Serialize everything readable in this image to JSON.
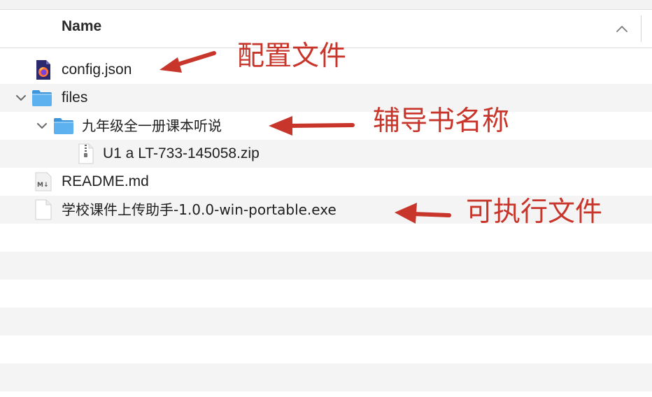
{
  "header": {
    "column_name": "Name",
    "sort_icon": "chevron-up-icon"
  },
  "rows": [
    {
      "label": "config.json",
      "icon": "firefox-json-file-icon",
      "expandable": false
    },
    {
      "label": "files",
      "icon": "folder-icon",
      "expandable": true,
      "expanded": true
    },
    {
      "label": "九年级全一册课本听说",
      "icon": "folder-icon",
      "expandable": true,
      "expanded": true
    },
    {
      "label": "U1 a LT-733-145058.zip",
      "icon": "zip-archive-icon",
      "expandable": false
    },
    {
      "label": "README.md",
      "icon": "markdown-file-icon",
      "expandable": false
    },
    {
      "label": "学校课件上传助手-1.0.0-win-portable.exe",
      "icon": "generic-file-icon",
      "expandable": false
    }
  ],
  "annotations": {
    "config_file": "配置文件",
    "book_name": "辅导书名称",
    "executable": "可执行文件"
  },
  "colors": {
    "annotation_red": "#c8352a",
    "folder_blue": "#4fa6e8",
    "zebra_row": "#f4f4f4"
  }
}
